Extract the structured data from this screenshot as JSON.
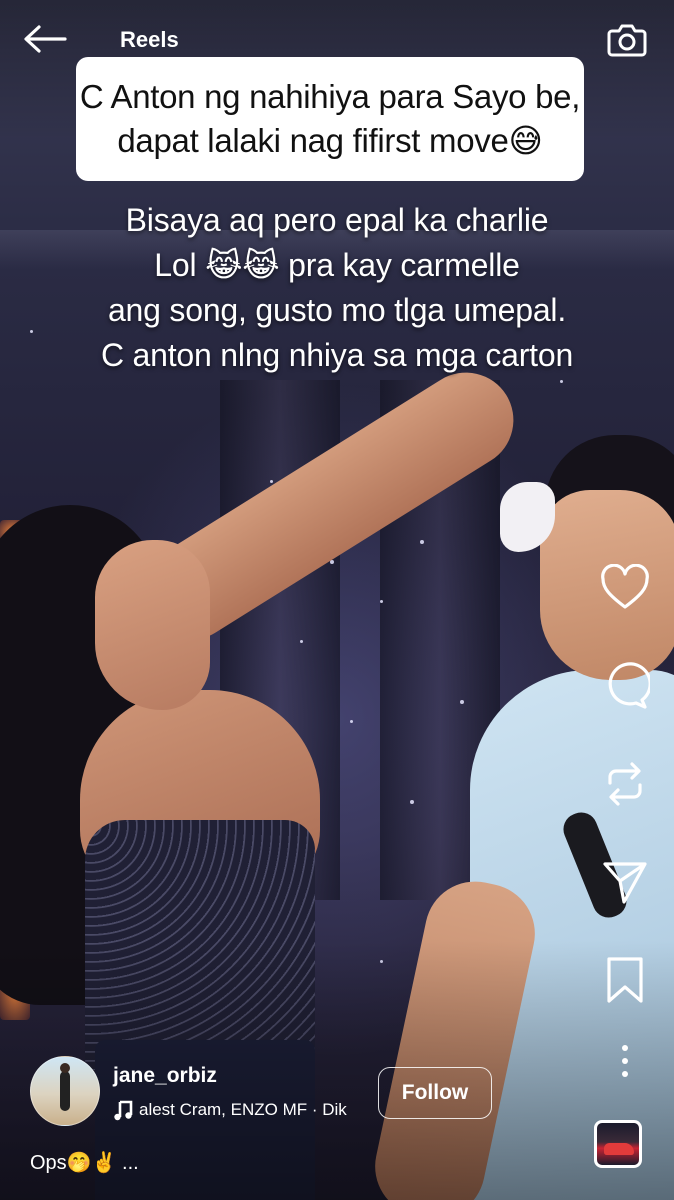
{
  "header": {
    "title": "Reels",
    "back_icon": "arrow-left-icon",
    "camera_icon": "camera-icon"
  },
  "captions": {
    "box_lines": [
      "C Anton ng nahihiya para Sayo be,",
      "dapat lalaki nag fifirst move😅"
    ],
    "text_lines": [
      "Bisaya aq pero epal ka charlie",
      "Lol 😹😹 pra kay carmelle",
      "ang song, gusto mo tlga umepal.",
      "C anton nlng nhiya sa mga carton"
    ]
  },
  "actions": [
    {
      "name": "like-button",
      "icon": "heart-icon"
    },
    {
      "name": "comment-button",
      "icon": "comment-icon"
    },
    {
      "name": "remix-button",
      "icon": "repost-icon"
    },
    {
      "name": "share-button",
      "icon": "send-icon"
    },
    {
      "name": "save-button",
      "icon": "bookmark-icon"
    },
    {
      "name": "more-button",
      "icon": "more-vertical-icon"
    }
  ],
  "user": {
    "username": "jane_orbiz",
    "audio": "alest Cram, ENZO MF · Dik",
    "audio_icon": "music-note-icon",
    "follow_label": "Follow"
  },
  "post": {
    "caption": "Ops🤭✌️ ..."
  },
  "colors": {
    "text": "#ffffff",
    "caption_box_bg": "#ffffff",
    "caption_box_text": "#111111"
  }
}
